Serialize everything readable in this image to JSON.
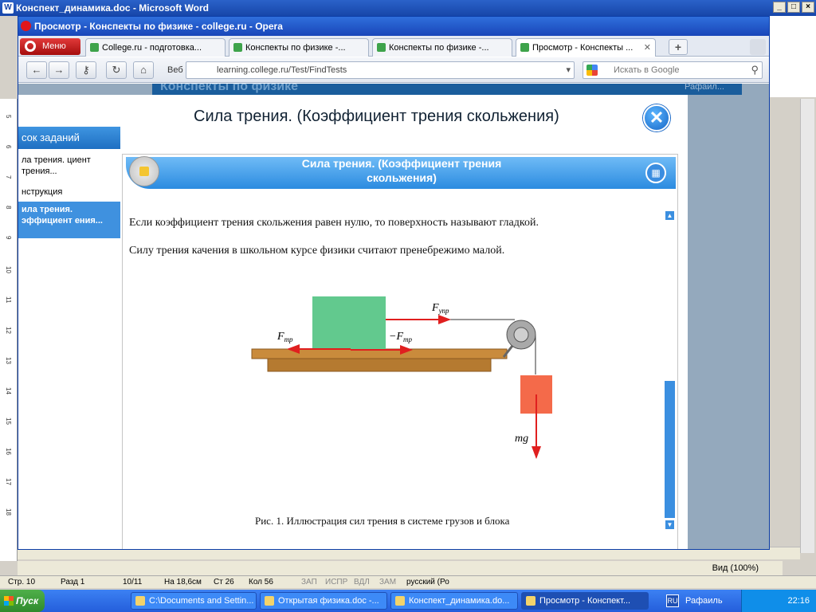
{
  "word": {
    "title": "Конспект_динамика.doc - Microsoft Word",
    "ruler_numbers": [
      "5",
      "6",
      "7",
      "8",
      "9",
      "10",
      "11",
      "12",
      "13",
      "14",
      "15",
      "16",
      "17",
      "18"
    ],
    "status": {
      "page": "Стр. 10",
      "section": "Разд 1",
      "pages": "10/11",
      "at": "На 18,6см",
      "line": "Ст 26",
      "col": "Кол 56",
      "rec": "ЗАП",
      "trk": "ИСПР",
      "ext": "ВДЛ",
      "ovr": "ЗАМ",
      "lang": "русский (Ро"
    },
    "zoom": "Вид (100%)"
  },
  "opera": {
    "title": "Просмотр - Конспекты по физике - college.ru - Opera",
    "menu_label": "Меню",
    "tabs": [
      {
        "label": "College.ru - подготовка..."
      },
      {
        "label": "Конспекты по физике -..."
      },
      {
        "label": "Конспекты по физике -..."
      },
      {
        "label": "Просмотр - Конспекты ..."
      }
    ],
    "address_prefix": "Веб",
    "url": "learning.college.ru/Test/FindTests",
    "search_placeholder": "Искать в Google"
  },
  "page": {
    "site_header": "Конспекты по физике",
    "user": "Рафаил...",
    "modal_title": "Сила трения. (Коэффициент трения скольжения)",
    "task_header": "сок заданий",
    "tasks": [
      {
        "label": "ла трения. циент трения..."
      },
      {
        "label": "нструкция"
      },
      {
        "label": "ила трения. эффициент ения..."
      }
    ],
    "content_title_line1": "Сила трения. (Коэффициент трения",
    "content_title_line2": "скольжения)",
    "para1": "Если коэффициент трения скольжения равен нулю, то поверхность называют гладкой.",
    "para2": "Силу трения качения в школьном курсе физики считают пренебрежимо малой.",
    "caption": "Рис. 1. Иллюстрация сил трения в системе грузов и блока",
    "fig_labels": {
      "f_tr": "F",
      "f_tr_sub": "тр",
      "minus_f_tr": "−F",
      "f_upr": "F",
      "f_upr_sub": "упр",
      "mg": "mg"
    }
  },
  "taskbar": {
    "start": "Пуск",
    "items": [
      {
        "label": "C:\\Documents and Settin..."
      },
      {
        "label": "Открытая физика.doc -..."
      },
      {
        "label": "Конспект_динамика.do..."
      },
      {
        "label": "Просмотр - Конспект..."
      }
    ],
    "lang": "RU",
    "user": "Рафаиль",
    "clock": "22:16"
  }
}
